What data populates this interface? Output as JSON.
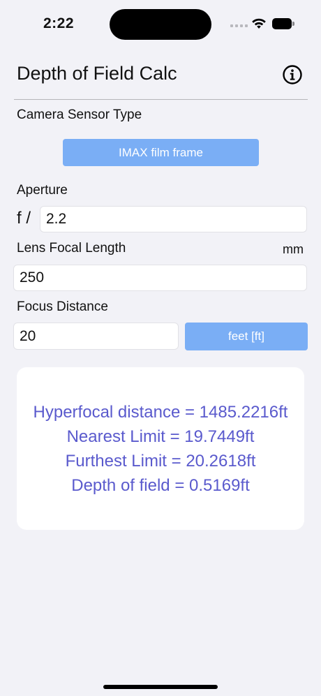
{
  "status_bar": {
    "time": "2:22"
  },
  "nav": {
    "title": "Depth of Field Calc",
    "info_icon": "info-circle-icon"
  },
  "sensor": {
    "label": "Camera Sensor Type",
    "button_label": "IMAX film frame"
  },
  "aperture": {
    "label": "Aperture",
    "prefix": "f /",
    "value": "2.2"
  },
  "focal_length": {
    "label": "Lens Focal Length",
    "unit": "mm",
    "value": "250"
  },
  "focus_distance": {
    "label": "Focus Distance",
    "value": "20",
    "unit_button_label": "feet [ft]"
  },
  "results": {
    "hyperfocal": "Hyperfocal distance = 1485.2216ft",
    "nearest": "Nearest Limit = 19.7449ft",
    "furthest": "Furthest Limit = 20.2618ft",
    "depth_of_field": "Depth of field = 0.5169ft"
  },
  "colors": {
    "accent_button": "#7aaef5",
    "result_text": "#5a5acd",
    "background": "#f2f2f7"
  }
}
